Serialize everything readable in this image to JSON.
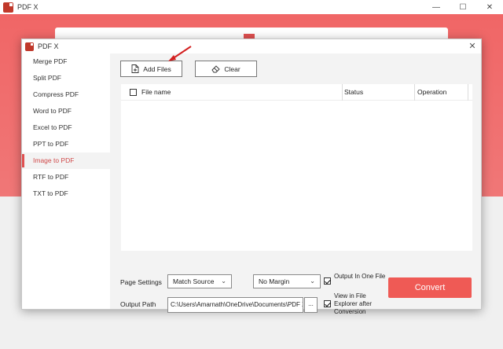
{
  "app": {
    "title": "PDF X"
  },
  "window_controls": {
    "minimize": "—",
    "maximize": "☐",
    "close": "✕"
  },
  "dialog": {
    "title": "PDF X",
    "close": "✕"
  },
  "sidebar": {
    "items": [
      {
        "label": "Merge PDF"
      },
      {
        "label": "Split PDF"
      },
      {
        "label": "Compress PDF"
      },
      {
        "label": "Word to PDF"
      },
      {
        "label": "Excel to PDF"
      },
      {
        "label": "PPT to PDF"
      },
      {
        "label": "Image to PDF",
        "active": true
      },
      {
        "label": "RTF to PDF"
      },
      {
        "label": "TXT to PDF"
      }
    ]
  },
  "toolbar": {
    "add_files": "Add Files",
    "clear": "Clear"
  },
  "table": {
    "columns": [
      "File name",
      "Status",
      "Operation"
    ]
  },
  "settings": {
    "page_settings_label": "Page Settings",
    "page_size": "Match Source",
    "margin": "No Margin",
    "output_in_one_file": "Output In One File",
    "output_in_one_file_checked": true,
    "output_path_label": "Output Path",
    "output_path": "C:\\Users\\Amarnath\\OneDrive\\Documents\\PDF X",
    "browse": "...",
    "view_in_explorer": "View in File Explorer after Conversion",
    "view_in_explorer_checked": true,
    "convert": "Convert"
  },
  "colors": {
    "accent": "#ef5a55",
    "active_text": "#d04a4a",
    "annotation_arrow": "#d32020"
  },
  "icons": [
    "pdfx-logo-icon",
    "add-file-icon",
    "eraser-icon",
    "chevron-down-icon",
    "checkbox-icon",
    "red-arrow-annotation"
  ]
}
